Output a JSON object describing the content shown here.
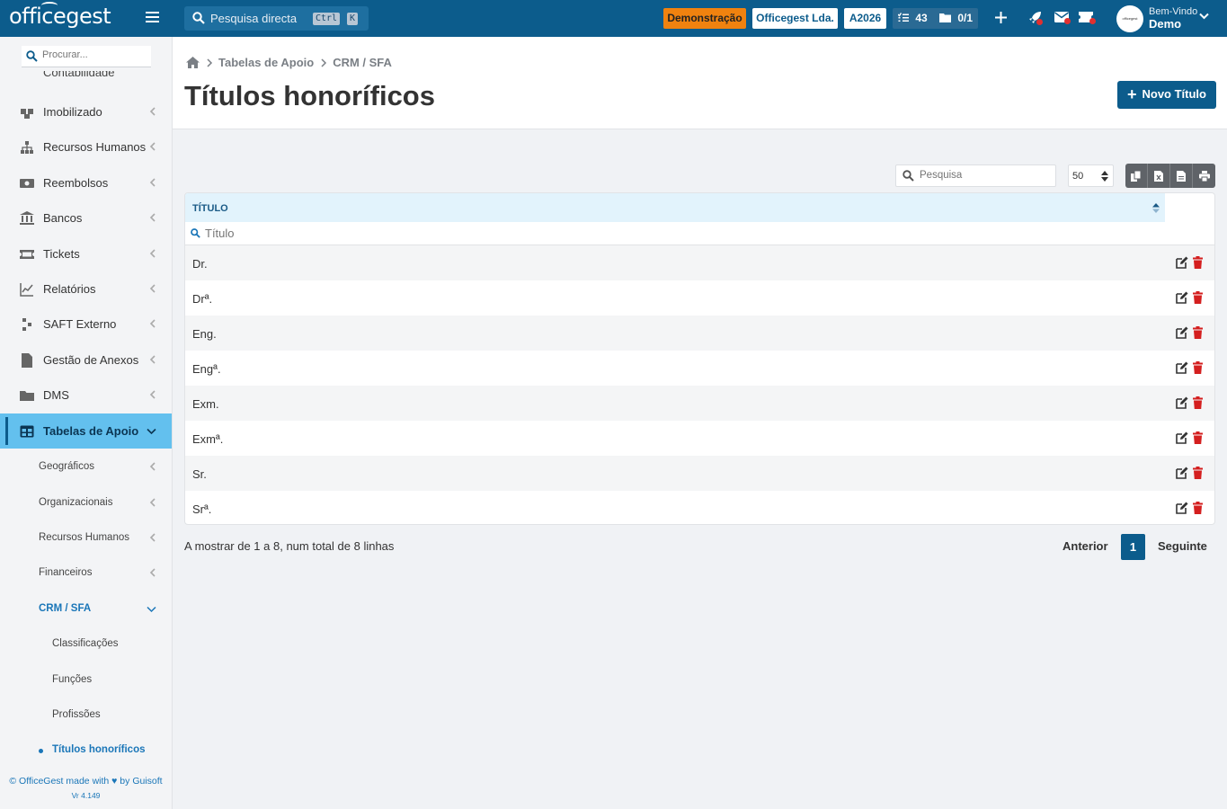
{
  "topbar": {
    "logo": "officegest",
    "search_placeholder": "Pesquisa directa",
    "shortcut_ctrl": "Ctrl",
    "shortcut_key": "K",
    "mode_badge": "Demonstração",
    "company": "Officegest Lda.",
    "year": "A2026",
    "tasks_count": "43",
    "docs_count": "0/1",
    "welcome": "Bem-Vindo",
    "username": "Demo",
    "avatar_text": "officegest",
    "icons": [
      "menu-icon",
      "search-icon",
      "tasks-icon",
      "folder-icon",
      "plus-icon",
      "rocket-icon",
      "mail-icon",
      "ticket-icon",
      "chevron-down-icon"
    ],
    "accent_color": "#0c5c8c",
    "demo_color": "#f0820f"
  },
  "sidebar": {
    "search_placeholder": "Procurar...",
    "cut_item": "Contabilidade",
    "items": [
      {
        "label": "Imobilizado",
        "icon": "boxes-icon"
      },
      {
        "label": "Recursos Humanos",
        "icon": "sitemap-icon"
      },
      {
        "label": "Reembolsos",
        "icon": "money-icon"
      },
      {
        "label": "Bancos",
        "icon": "bank-icon"
      },
      {
        "label": "Tickets",
        "icon": "ticket-icon"
      },
      {
        "label": "Relatórios",
        "icon": "chart-icon"
      },
      {
        "label": "SAFT Externo",
        "icon": "saft-icon"
      },
      {
        "label": "Gestão de Anexos",
        "icon": "file-icon"
      },
      {
        "label": "DMS",
        "icon": "folder-icon"
      },
      {
        "label": "Tabelas de Apoio",
        "icon": "table-icon"
      }
    ],
    "subitems": [
      "Geográficos",
      "Organizacionais",
      "Recursos Humanos",
      "Financeiros",
      "CRM / SFA"
    ],
    "crm_items": [
      "Classificações",
      "Funções",
      "Profissões",
      "Títulos honoríficos"
    ],
    "footer_text": "© OfficeGest made with ♥ by Guisoft",
    "version": "Vr 4.149",
    "active_color": "#63c0ee"
  },
  "page": {
    "breadcrumb": [
      "Tabelas de Apoio",
      "CRM / SFA"
    ],
    "title": "Títulos honoríficos",
    "new_button": "Novo Título"
  },
  "toolbar": {
    "search_placeholder": "Pesquisa",
    "page_size": "50",
    "export_icons": [
      "copy-icon",
      "excel-icon",
      "pdf-icon",
      "print-icon"
    ]
  },
  "table": {
    "column": "TÍTULO",
    "filter_placeholder": "Título",
    "rows": [
      "Dr.",
      "Drª.",
      "Eng.",
      "Engª.",
      "Exm.",
      "Exmª.",
      "Sr.",
      "Srª."
    ]
  },
  "pagination": {
    "info": "A mostrar de 1 a 8, num total de 8 linhas",
    "prev": "Anterior",
    "current": "1",
    "next": "Seguinte"
  }
}
